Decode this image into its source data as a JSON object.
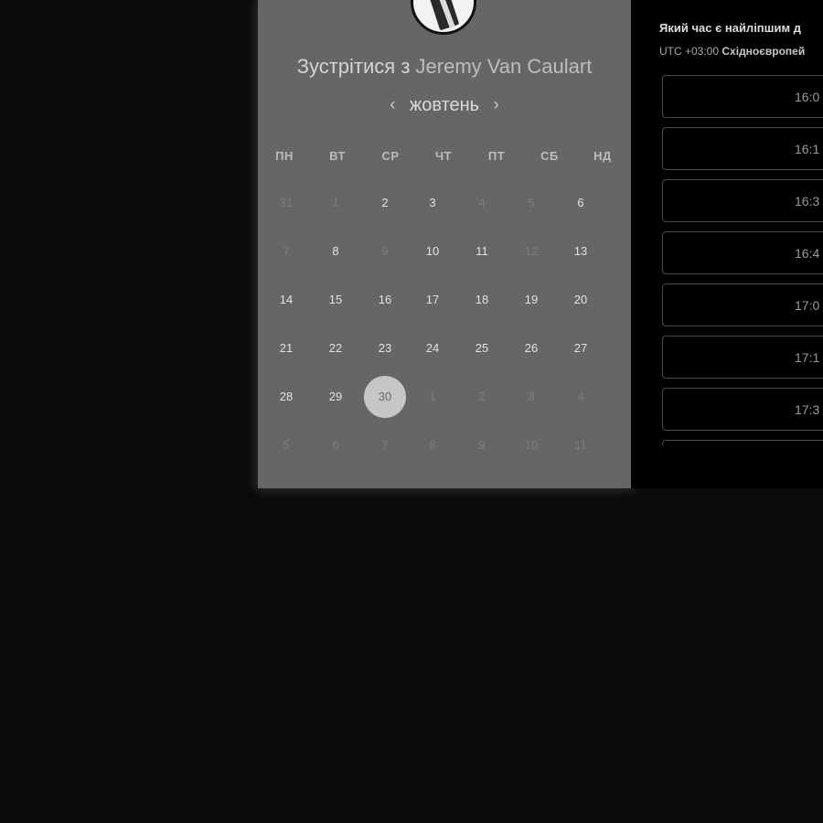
{
  "header": {
    "title_prefix": "Зустрітися з",
    "host_name": "Jeremy Van Caulart"
  },
  "calendar": {
    "month": "жовтень",
    "prev_arrow": "‹",
    "next_arrow": "›",
    "weekdays": [
      "ПН",
      "ВТ",
      "СР",
      "ЧТ",
      "ПТ",
      "СБ",
      "НД"
    ],
    "weeks": [
      [
        {
          "d": "31",
          "m": true
        },
        {
          "d": "1",
          "m": true
        },
        {
          "d": "2"
        },
        {
          "d": "3"
        },
        {
          "d": "4",
          "m": true
        },
        {
          "d": "5",
          "m": true
        },
        {
          "d": "6"
        }
      ],
      [
        {
          "d": "7",
          "m": true
        },
        {
          "d": "8"
        },
        {
          "d": "9",
          "m": true
        },
        {
          "d": "10"
        },
        {
          "d": "11"
        },
        {
          "d": "12",
          "m": true
        },
        {
          "d": "13"
        }
      ],
      [
        {
          "d": "14"
        },
        {
          "d": "15"
        },
        {
          "d": "16"
        },
        {
          "d": "17"
        },
        {
          "d": "18"
        },
        {
          "d": "19"
        },
        {
          "d": "20"
        }
      ],
      [
        {
          "d": "21"
        },
        {
          "d": "22"
        },
        {
          "d": "23"
        },
        {
          "d": "24"
        },
        {
          "d": "25"
        },
        {
          "d": "26"
        },
        {
          "d": "27"
        }
      ],
      [
        {
          "d": "28"
        },
        {
          "d": "29"
        },
        {
          "d": "30",
          "s": true
        },
        {
          "d": "1",
          "m": true
        },
        {
          "d": "2",
          "m": true
        },
        {
          "d": "3",
          "m": true
        },
        {
          "d": "4",
          "m": true
        }
      ],
      [
        {
          "d": "5",
          "m": true
        },
        {
          "d": "6",
          "m": true
        },
        {
          "d": "7",
          "m": true
        },
        {
          "d": "8",
          "m": true
        },
        {
          "d": "9",
          "m": true
        },
        {
          "d": "10",
          "m": true
        },
        {
          "d": "11",
          "m": true
        }
      ]
    ]
  },
  "times": {
    "question": "Який час є найліпшим д",
    "tz_offset": "UTC +03:00",
    "tz_name": "Східноєвропей",
    "slots": [
      "16:0",
      "16:1",
      "16:3",
      "16:4",
      "17:0",
      "17:1",
      "17:3"
    ]
  }
}
